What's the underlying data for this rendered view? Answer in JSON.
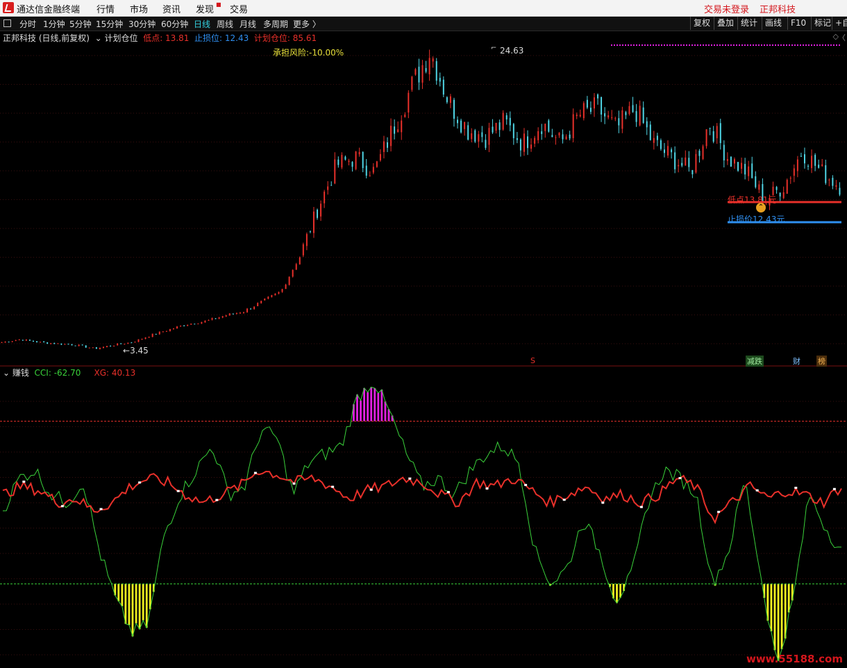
{
  "menu": {
    "app_title": "通达信金融终端",
    "items": [
      "行情",
      "市场",
      "资讯",
      "发现",
      "交易"
    ],
    "login_status": "交易未登录",
    "stock_name": "正邦科技"
  },
  "toolbar": {
    "periods": [
      "分时",
      "1分钟",
      "5分钟",
      "15分钟",
      "30分钟",
      "60分钟",
      "日线",
      "周线",
      "月线",
      "多周期",
      "更多 〉"
    ],
    "active_period": "日线",
    "right_buttons": [
      "复权",
      "叠加",
      "统计",
      "画线",
      "F10",
      "标记",
      "+自"
    ]
  },
  "price_panel": {
    "title": "正邦科技 (日线,前复权)",
    "indicator": "计划仓位",
    "low_label": "低点: 13.81",
    "stop_label": "止损位: 12.43",
    "plan_label": "计划仓位: 85.61",
    "risk_label": "承担风险:-10.00%",
    "high_mark": "24.63",
    "low_mark": "3.45",
    "low_line_label": "低点13.81元",
    "stop_line_label": "止损价12.43元",
    "event_badges": [
      "减跌",
      "财",
      "榜"
    ],
    "s_marker": "S"
  },
  "cci_panel": {
    "indicator_name": "赚钱",
    "cci_label": "CCI: -62.70",
    "xg_label": "XG: 40.13"
  },
  "watermark": "www.55188.com",
  "colors": {
    "up": "#e8302a",
    "down": "#4fd6e6",
    "cci_line": "#3ad23a",
    "xg_line": "#e8302a",
    "magenta_bar": "#e020e0",
    "yellow_bar": "#f0f020",
    "stop_line": "#2f8ff0"
  },
  "chart_data": {
    "type": "candlestick",
    "price_high": 24.63,
    "price_low": 3.45,
    "current_low_line": 13.81,
    "stop_loss_line": 12.43,
    "price_anchors": [
      3.9,
      4.1,
      3.9,
      3.8,
      3.7,
      3.45,
      3.7,
      3.9,
      4.4,
      4.8,
      5.2,
      5.4,
      5.8,
      6.1,
      6.8,
      7.5,
      10,
      13.5,
      16.5,
      17,
      16,
      19,
      22,
      24.63,
      21,
      19,
      18.5,
      19.5,
      18,
      19.5,
      18,
      20,
      20.5,
      19,
      20.5,
      18,
      17,
      16,
      19.5,
      17,
      16,
      14,
      15,
      17.5,
      16,
      15
    ],
    "cci_range": [
      -200,
      150
    ],
    "cci_upper_level": 100,
    "cci_lower_level": -100,
    "cci_anchors": [
      -10,
      30,
      40,
      10,
      0,
      25,
      -60,
      -120,
      -160,
      -150,
      -40,
      10,
      40,
      70,
      10,
      20,
      90,
      80,
      10,
      50,
      60,
      70,
      130,
      150,
      110,
      60,
      20,
      30,
      10,
      40,
      60,
      70,
      50,
      -60,
      -100,
      -80,
      -20,
      -60,
      -120,
      -90,
      0,
      40,
      30,
      10,
      -100,
      -60,
      30,
      -90,
      -200,
      -120,
      10,
      -30,
      -60
    ],
    "xg_anchors": [
      10,
      20,
      15,
      0,
      5,
      -10,
      0,
      20,
      30,
      25,
      10,
      0,
      10,
      20,
      40,
      35,
      25,
      30,
      20,
      5,
      15,
      20,
      30,
      25,
      10,
      0,
      25,
      20,
      30,
      15,
      0,
      10,
      20,
      5,
      10,
      0,
      10,
      30,
      20,
      -20,
      0,
      20,
      5,
      15,
      10,
      0,
      20
    ]
  }
}
